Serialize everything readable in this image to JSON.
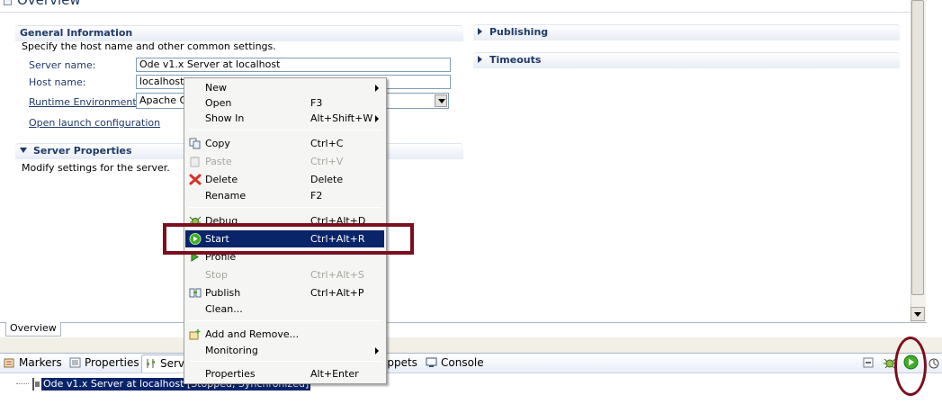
{
  "editor": {
    "title": "Overview",
    "general": {
      "heading": "General Information",
      "description": "Specify the host name and other common settings.",
      "server_name_label": "Server name:",
      "server_name_value": "Ode v1.x Server at localhost",
      "host_name_label": "Host name:",
      "host_name_value": "localhost",
      "runtime_label": "Runtime Environment:",
      "runtime_value": "Apache Ode",
      "launch_link": "Open launch configuration"
    },
    "server_properties": {
      "heading": "Server Properties",
      "description": "Modify settings for the server."
    },
    "publishing_heading": "Publishing",
    "timeouts_heading": "Timeouts",
    "bottom_tab": "Overview"
  },
  "views": {
    "markers": "Markers",
    "properties": "Properties",
    "servers": "Serv",
    "snippets": "ippets",
    "console": "Console"
  },
  "server_row": "Ode v1.x Server at localhost  [Stopped, Synchronized]",
  "context_menu": {
    "items": [
      {
        "label": "New",
        "accel": "",
        "submenu": true
      },
      {
        "label": "Open",
        "accel": "F3"
      },
      {
        "label": "Show In",
        "accel": "Alt+Shift+W",
        "submenu": true
      },
      {
        "label": "Copy",
        "accel": "Ctrl+C",
        "icon": "copy-icon"
      },
      {
        "label": "Paste",
        "accel": "Ctrl+V",
        "disabled": true,
        "icon": "paste-icon"
      },
      {
        "label": "Delete",
        "accel": "Delete",
        "icon": "delete-icon"
      },
      {
        "label": "Rename",
        "accel": "F2"
      },
      {
        "label": "Debug",
        "accel": "Ctrl+Alt+D",
        "icon": "debug-icon"
      },
      {
        "label": "Start",
        "accel": "Ctrl+Alt+R",
        "icon": "start-icon",
        "highlighted": true
      },
      {
        "label": "Profile",
        "accel": "",
        "icon": "profile-icon"
      },
      {
        "label": "Stop",
        "accel": "Ctrl+Alt+S",
        "disabled": true
      },
      {
        "label": "Publish",
        "accel": "Ctrl+Alt+P",
        "icon": "publish-icon"
      },
      {
        "label": "Clean...",
        "accel": ""
      },
      {
        "label": "Add and Remove...",
        "accel": "",
        "icon": "add-remove-icon"
      },
      {
        "label": "Monitoring",
        "accel": "",
        "submenu": true
      },
      {
        "label": "Properties",
        "accel": "Alt+Enter"
      }
    ]
  },
  "colors": {
    "highlight": "#0a246a",
    "annotation": "#7b0f1e",
    "section_text": "#1f3a68"
  }
}
